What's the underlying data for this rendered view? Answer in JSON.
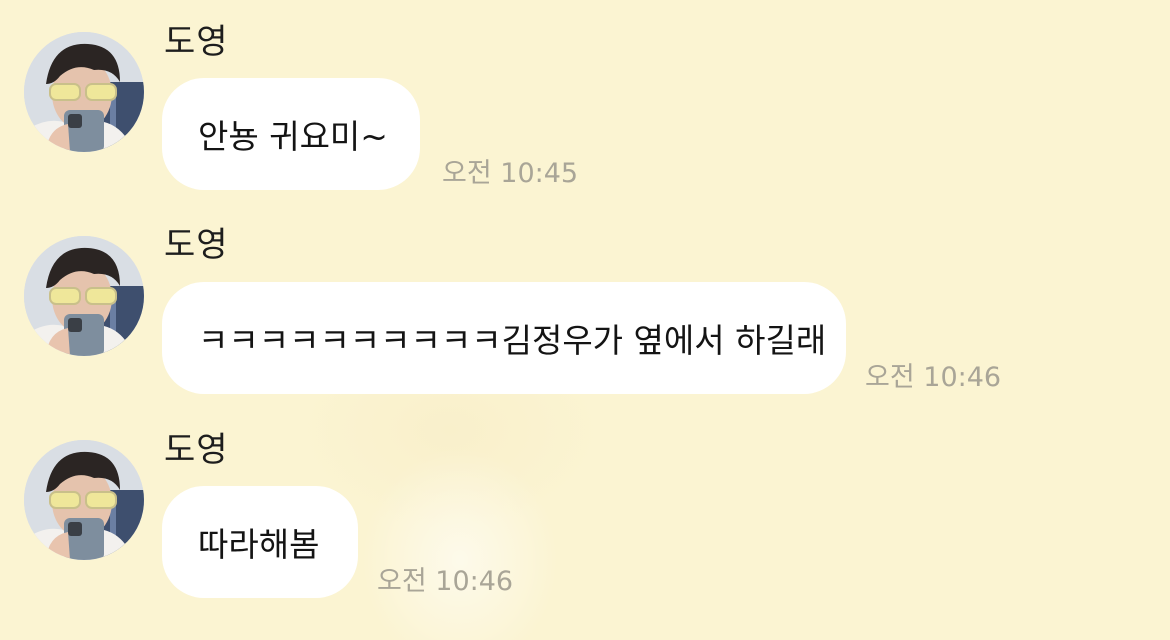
{
  "messages": [
    {
      "sender": "도영",
      "text": "안뇽 귀요미~",
      "time": "오전 10:45"
    },
    {
      "sender": "도영",
      "text": "ㅋㅋㅋㅋㅋㅋㅋㅋㅋㅋ김정우가 옆에서 하길래",
      "time": "오전 10:46"
    },
    {
      "sender": "도영",
      "text": "따라해봄",
      "time": "오전 10:46"
    }
  ],
  "avatar_icon": "profile-photo-avatar"
}
